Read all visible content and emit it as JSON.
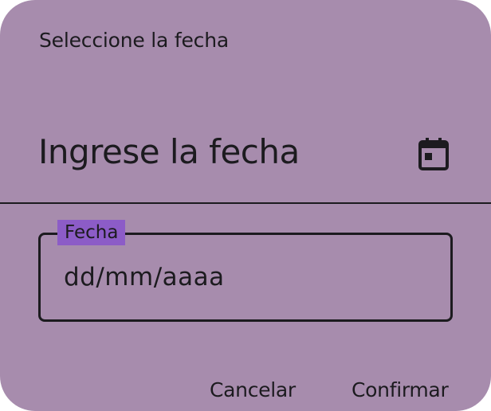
{
  "dialog": {
    "subtitle": "Seleccione la fecha",
    "headline": "Ingrese la fecha",
    "mode_toggle_icon": "calendar-icon",
    "background_color": "#a78cad"
  },
  "date_field": {
    "label": "Fecha",
    "value": "",
    "placeholder": "dd/mm/aaaa",
    "label_color": "#8c5cc7"
  },
  "actions": {
    "cancel_label": "Cancelar",
    "confirm_label": "Confirmar"
  }
}
